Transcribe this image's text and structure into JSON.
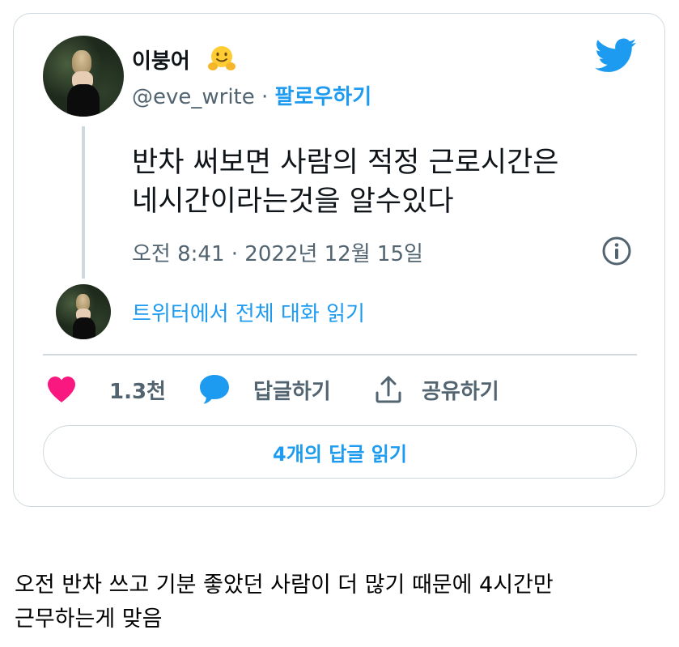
{
  "tweet": {
    "author_name": "이붕어",
    "author_handle": "@eve_write",
    "separator": " · ",
    "follow_label": "팔로우하기",
    "text_line1": "반차 써보면 사람의 적정 근로시간은",
    "text_line2": "네시간이라는것을 알수있다",
    "timestamp": "오전 8:41 · 2022년 12월 15일",
    "conversation_link": "트위터에서 전체 대화 읽기",
    "actions": {
      "like_count": "1.3천",
      "reply_label": "답글하기",
      "share_label": "공유하기"
    },
    "read_replies_label": "4개의 답글 읽기"
  },
  "caption": {
    "line1": "오전 반차 쓰고 기분 좋았던 사람이 더 많기 때문에 4시간만",
    "line2": "근무하는게 맞음"
  },
  "icons": {
    "emoji": "smiling-face-with-open-hands-emoji",
    "brand": "twitter-bird-icon",
    "info": "info-icon",
    "like": "heart-icon",
    "reply": "speech-bubble-icon",
    "share": "share-icon"
  },
  "colors": {
    "accent": "#1d9bf0",
    "like": "#f91880",
    "muted": "#536471",
    "border": "#cfd9de"
  }
}
